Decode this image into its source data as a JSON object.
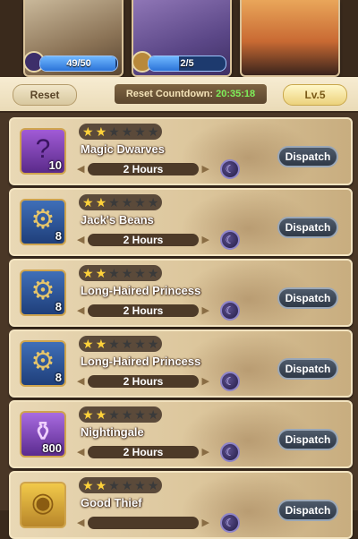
{
  "banners": [
    {
      "progress_text": "49/50",
      "progress_value": 0.98
    },
    {
      "progress_text": "2/5",
      "progress_value": 0.4
    },
    {}
  ],
  "header": {
    "reset_label": "Reset",
    "countdown_label": "Reset Countdown:",
    "countdown_time": "20:35:18",
    "level_label": "Lv.5"
  },
  "quests": [
    {
      "name": "Magic Dwarves",
      "stars": 2,
      "max_stars": 6,
      "duration": "2 Hours",
      "item_icon": "purple-hero-shard-icon",
      "item_qty": "10",
      "dispatch_label": "Dispatch"
    },
    {
      "name": "Jack's Beans",
      "stars": 2,
      "max_stars": 6,
      "duration": "2 Hours",
      "item_icon": "gear-icon",
      "item_qty": "8",
      "dispatch_label": "Dispatch"
    },
    {
      "name": "Long-Haired Princess",
      "stars": 2,
      "max_stars": 6,
      "duration": "2 Hours",
      "item_icon": "gear-icon",
      "item_qty": "8",
      "dispatch_label": "Dispatch"
    },
    {
      "name": "Long-Haired Princess",
      "stars": 2,
      "max_stars": 6,
      "duration": "2 Hours",
      "item_icon": "gear-icon",
      "item_qty": "8",
      "dispatch_label": "Dispatch"
    },
    {
      "name": "Nightingale",
      "stars": 2,
      "max_stars": 6,
      "duration": "2 Hours",
      "item_icon": "potion-icon",
      "item_qty": "800",
      "dispatch_label": "Dispatch"
    },
    {
      "name": "Good Thief",
      "stars": 2,
      "max_stars": 6,
      "duration": "",
      "item_icon": "gold-coin-icon",
      "item_qty": "",
      "dispatch_label": "Dispatch"
    }
  ],
  "colors": {
    "star_on": "#ffd23a",
    "countdown_time": "#7ef05a",
    "dispatch_bg": "#3a4554"
  }
}
